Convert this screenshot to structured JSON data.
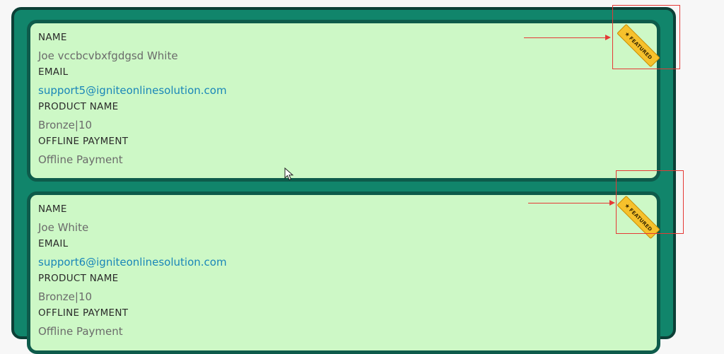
{
  "badge": {
    "text": "FEATURED",
    "star": "★"
  },
  "cards": [
    {
      "name_label": "NAME",
      "name_value": "Joe vccbcvbxfgdgsd White",
      "email_label": "EMAIL",
      "email_value": "support5@igniteonlinesolution.com",
      "product_label": "PRODUCT NAME",
      "product_value": "Bronze|10",
      "payment_label": "OFFLINE PAYMENT",
      "payment_value": "Offline Payment"
    },
    {
      "name_label": "NAME",
      "name_value": "Joe White",
      "email_label": "EMAIL",
      "email_value": "support6@igniteonlinesolution.com",
      "product_label": "PRODUCT NAME",
      "product_value": "Bronze|10",
      "payment_label": "OFFLINE PAYMENT",
      "payment_value": "Offline Payment"
    }
  ],
  "colors": {
    "panel": "#11856b",
    "card": "#cdf8c6",
    "badge": "#f6c12c",
    "annotation": "#e53935",
    "link": "#1a86b8"
  }
}
